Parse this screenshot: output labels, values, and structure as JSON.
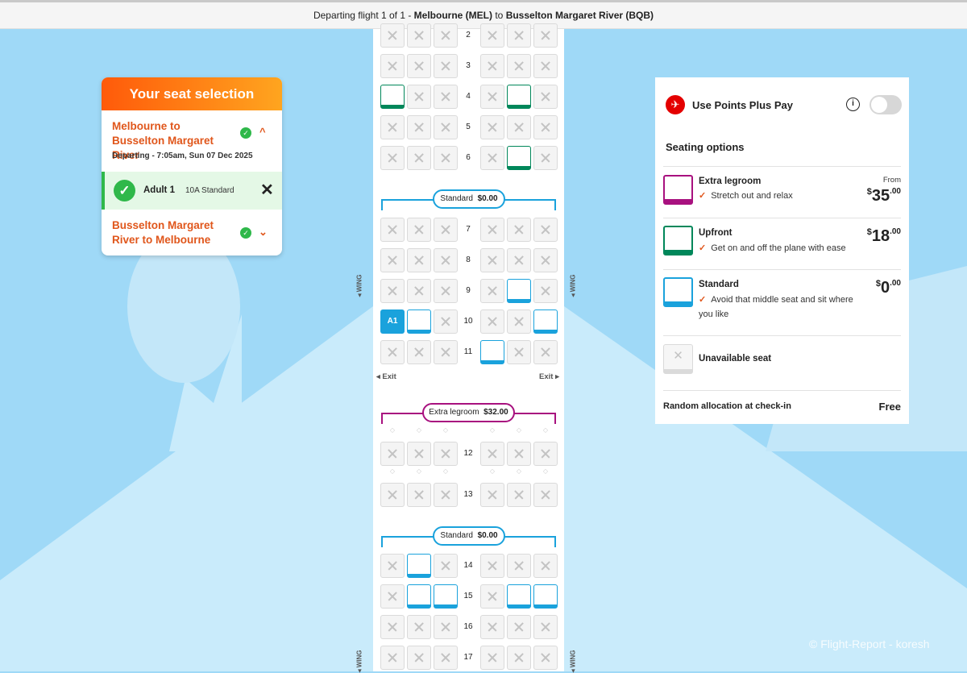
{
  "header": {
    "prefix": "Departing flight 1 of 1  - ",
    "origin": "Melbourne (MEL)",
    "joiner": " to ",
    "destination": "Busselton Margaret River (BQB)"
  },
  "selection_card": {
    "title": "Your seat selection",
    "outbound_route": "Melbourne to Busselton Margaret River",
    "departing": "Departing - 7:05am, Sun 07 Dec 2025",
    "passenger_name": "Adult 1",
    "passenger_seat": "10A Standard",
    "return_route": "Busselton Margaret River to Melbourne"
  },
  "seat_map": {
    "rows": [
      {
        "num": "2",
        "seats": [
          "na",
          "na",
          "na",
          "na",
          "na",
          "na"
        ]
      },
      {
        "num": "3",
        "seats": [
          "na",
          "na",
          "na",
          "na",
          "na",
          "na"
        ]
      },
      {
        "num": "4",
        "seats": [
          "up",
          "na",
          "na",
          "na",
          "up",
          "na"
        ]
      },
      {
        "num": "5",
        "seats": [
          "na",
          "na",
          "na",
          "na",
          "na",
          "na"
        ]
      },
      {
        "num": "6",
        "seats": [
          "na",
          "na",
          "na",
          "na",
          "up",
          "na"
        ]
      },
      {
        "num": "7",
        "seats": [
          "na",
          "na",
          "na",
          "na",
          "na",
          "na"
        ]
      },
      {
        "num": "8",
        "seats": [
          "na",
          "na",
          "na",
          "na",
          "na",
          "na"
        ]
      },
      {
        "num": "9",
        "seats": [
          "na",
          "na",
          "na",
          "na",
          "st",
          "na"
        ]
      },
      {
        "num": "10",
        "seats": [
          "sel",
          "st",
          "na",
          "na",
          "na",
          "st"
        ]
      },
      {
        "num": "11",
        "seats": [
          "na",
          "na",
          "na",
          "st",
          "na",
          "na"
        ]
      },
      {
        "num": "12",
        "seats": [
          "na",
          "na",
          "na",
          "na",
          "na",
          "na"
        ]
      },
      {
        "num": "13",
        "seats": [
          "na",
          "na",
          "na",
          "na",
          "na",
          "na"
        ]
      },
      {
        "num": "14",
        "seats": [
          "na",
          "st",
          "na",
          "na",
          "na",
          "na"
        ]
      },
      {
        "num": "15",
        "seats": [
          "na",
          "st",
          "st",
          "na",
          "st",
          "st"
        ]
      },
      {
        "num": "16",
        "seats": [
          "na",
          "na",
          "na",
          "na",
          "na",
          "na"
        ]
      },
      {
        "num": "17",
        "seats": [
          "na",
          "na",
          "na",
          "na",
          "na",
          "na"
        ]
      }
    ],
    "selected_seat_label": "A1",
    "zone_standard_1": {
      "name": "Standard",
      "price": "$0.00"
    },
    "zone_extra": {
      "name": "Extra legroom",
      "price": "$32.00"
    },
    "zone_standard_2": {
      "name": "Standard",
      "price": "$0.00"
    },
    "exit_label": "Exit",
    "wing_label": "WING"
  },
  "options_panel": {
    "points_plus_pay": "Use Points Plus Pay",
    "info_glyph": "i",
    "heading": "Seating options",
    "options": [
      {
        "name": "Extra legroom",
        "desc": "Stretch out and relax",
        "from": "From",
        "currency": "$",
        "dollars": "35",
        "cents": ".00",
        "color": "#a8117f"
      },
      {
        "name": "Upfront",
        "desc": "Get on and off the plane with ease",
        "currency": "$",
        "dollars": "18",
        "cents": ".00",
        "color": "#00875a"
      },
      {
        "name": "Standard",
        "desc": "Avoid that middle seat and sit where you like",
        "currency": "$",
        "dollars": "0",
        "cents": ".00",
        "color": "#1aa2dc"
      }
    ],
    "unavailable": "Unavailable seat",
    "random_label": "Random allocation at check-in",
    "random_price": "Free"
  },
  "watermark": "© Flight-Report - koresh",
  "colors": {
    "sky": "#9fd9f7",
    "accent_orange": "#e0561b",
    "standard_blue": "#1aa2dc",
    "upfront_green": "#00875a",
    "extra_purple": "#a8117f",
    "success_green": "#2fb84a"
  }
}
